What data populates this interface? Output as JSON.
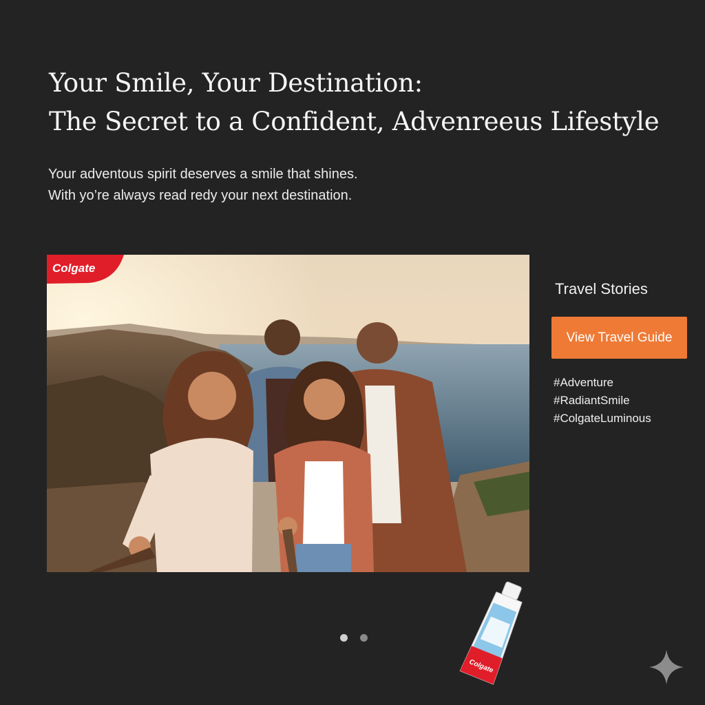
{
  "headline": {
    "line1": "Your Smile, Your Destination:",
    "line2": "The Secret to a Confident, Advenreeus Lifestyle"
  },
  "subtext": {
    "line1": "Your adventous spirit deserves a smile that shines.",
    "line2": "With yo’re always read  redy your next destination."
  },
  "hero": {
    "brand_logo_text": "Colgate",
    "image_icon": "group-selfie-photo"
  },
  "sidebar": {
    "title": "Travel Stories",
    "cta_label": "View Travel Guide",
    "hashtags": [
      "#Adventure",
      "#RadiantSmile",
      "#ColgateLuminous"
    ]
  },
  "carousel": {
    "dot_count": 2,
    "active_index": 0
  },
  "product": {
    "icon": "toothpaste-tube",
    "label": "Colgate"
  },
  "decor": {
    "icon": "sparkle-icon"
  },
  "colors": {
    "background": "#232323",
    "accent": "#ee7a35",
    "brand_red": "#e01e2a"
  }
}
